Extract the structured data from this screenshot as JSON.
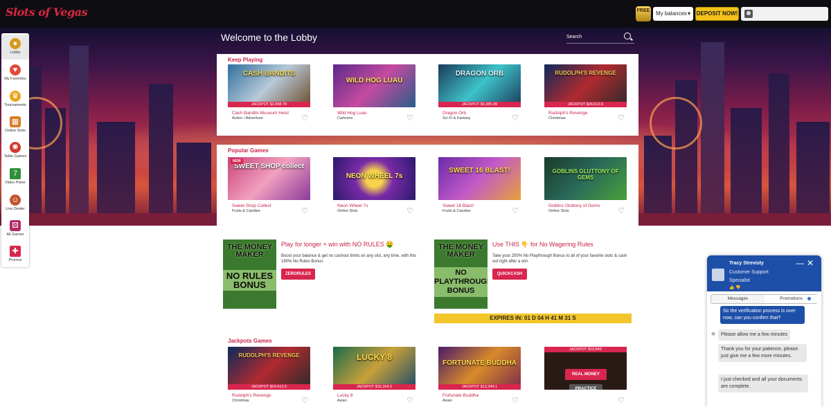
{
  "header": {
    "logo_text": "Slots of Vegas",
    "free_badge": "FREE",
    "balances_label": "My balances",
    "deposit_label": "DEPOSIT NOW!"
  },
  "sidebar": {
    "items": [
      {
        "label": "Lobby",
        "icon": "chip-icon"
      },
      {
        "label": "My Favorites",
        "icon": "heart-icon"
      },
      {
        "label": "Tournaments",
        "icon": "trophy-icon"
      },
      {
        "label": "Online Slots",
        "icon": "slot-machine-icon"
      },
      {
        "label": "Table Games",
        "icon": "roulette-icon"
      },
      {
        "label": "Video Poker",
        "icon": "seven-icon"
      },
      {
        "label": "Live Dealer",
        "icon": "dealer-icon"
      },
      {
        "label": "All Games",
        "icon": "dice-icon"
      },
      {
        "label": "Promos",
        "icon": "gift-icon"
      }
    ]
  },
  "lobby": {
    "title": "Welcome to the Lobby",
    "search_placeholder": "Search"
  },
  "keep_playing": {
    "title": "Keep Playing",
    "games": [
      {
        "art": "CASH BANDITS",
        "jackpot": "JACKPOT $2,898.78",
        "name": "Cash Bandits Museum Heist",
        "category": "Action / Adventure"
      },
      {
        "art": "WILD HOG LUAU",
        "jackpot": "",
        "name": "Wild Hog Luau",
        "category": "Cartoons"
      },
      {
        "art": "DRAGON ORB",
        "jackpot": "JACKPOT $5,385.39",
        "name": "Dragon Orb",
        "category": "Sci-Fi & Fantasy"
      },
      {
        "art": "RUDOLPH'S REVENGE",
        "jackpot": "JACKPOT $24,612.6",
        "name": "Rudolph's Revenge",
        "category": "Christmas"
      }
    ]
  },
  "popular_games": {
    "title": "Popular Games",
    "new_badge": "NEW",
    "games": [
      {
        "art": "SWEET SHOP collect",
        "name": "Sweet Shop Collect",
        "category": "Fruits & Candies"
      },
      {
        "art": "NEON WHEEL 7s",
        "name": "Neon Wheel 7s",
        "category": "Online Slots"
      },
      {
        "art": "SWEET 16 BLAST!",
        "name": "Sweet 16 Blast!",
        "category": "Fruits & Candies"
      },
      {
        "art": "GOBLINS GLUTTONY OF GEMS",
        "name": "Goblins Gluttony of Gems",
        "category": "Online Slots"
      }
    ]
  },
  "promos": [
    {
      "art_top": "THE MONEY MAKER",
      "art_main": "NO RULES BONUS",
      "title": "Play for longer + win with NO RULES 🤑",
      "text": "Boost your balance & get no cashout limits on any slot, any time, with this 190% No Rules Bonus",
      "button": "ZERORULES"
    },
    {
      "art_top": "THE MONEY MAKER",
      "art_main": "NO PLAYTHROUGH BONUS",
      "title": "Use THIS 👇 for No Wagering Rules",
      "text": "Take your 250% No Playthrough Bonus to all of your favorite slots & cash out right after a win",
      "button": "QUICKCASH"
    }
  ],
  "expires": "EXPIRES IN:   01 D 04 H 41 M 31 S",
  "jackpots": {
    "title": "Jackpots Games",
    "games": [
      {
        "art": "RUDOLPH'S REVENGE",
        "jackpot": "JACKPOT $24,612.6",
        "name": "Rudolph's Revenge",
        "category": "Christmas"
      },
      {
        "art": "LUCKY 8",
        "jackpot": "JACKPOT $15,154.2",
        "name": "Lucky 8",
        "category": "Asian"
      },
      {
        "art": "FORTUNATE BUDDHA",
        "jackpot": "JACKPOT $13,349.1",
        "name": "Fortunate Buddha",
        "category": "Asian"
      },
      {
        "art": "",
        "jackpot_top": "JACKPOT $10,849",
        "real_money": "REAL MONEY",
        "practice": "PRACTICE"
      }
    ]
  },
  "chat": {
    "agent_name": "Tracy Strevisty",
    "agent_role": "Customer Support Specialist",
    "tab_messages": "Messages",
    "tab_promotions": "Promotions",
    "messages": [
      {
        "from": "user",
        "text": "So the verification process is over now, can you confirm that?"
      },
      {
        "from": "agent",
        "text": "Please allow me a few minutes"
      },
      {
        "from": "agent",
        "text": "Thank you for your patience, please just give me a few more minutes."
      },
      {
        "from": "agent",
        "text": "I just checked and all your documents are complete."
      }
    ]
  },
  "colors": {
    "accent": "#d8264e",
    "deposit": "#f3c318",
    "chat_header": "#1e4fa8"
  }
}
